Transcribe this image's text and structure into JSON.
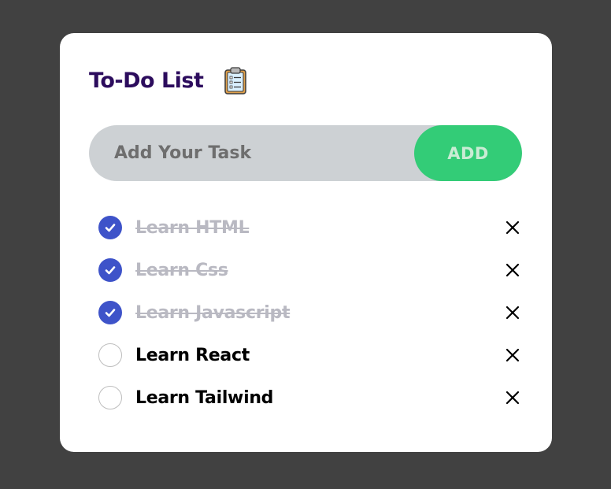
{
  "header": {
    "title": "To-Do List",
    "icon": "clipboard-icon"
  },
  "input": {
    "placeholder": "Add Your Task",
    "value": "",
    "add_label": "ADD"
  },
  "colors": {
    "background": "#414141",
    "card": "#ffffff",
    "title": "#2c0c5d",
    "add_button": "#33cc77",
    "checkbox_checked": "#3e53c9",
    "done_text": "#b9b9c2"
  },
  "tasks": [
    {
      "label": "Learn HTML",
      "done": true
    },
    {
      "label": "Learn Css",
      "done": true
    },
    {
      "label": "Learn Javascript",
      "done": true
    },
    {
      "label": "Learn React",
      "done": false
    },
    {
      "label": "Learn Tailwind",
      "done": false
    }
  ]
}
